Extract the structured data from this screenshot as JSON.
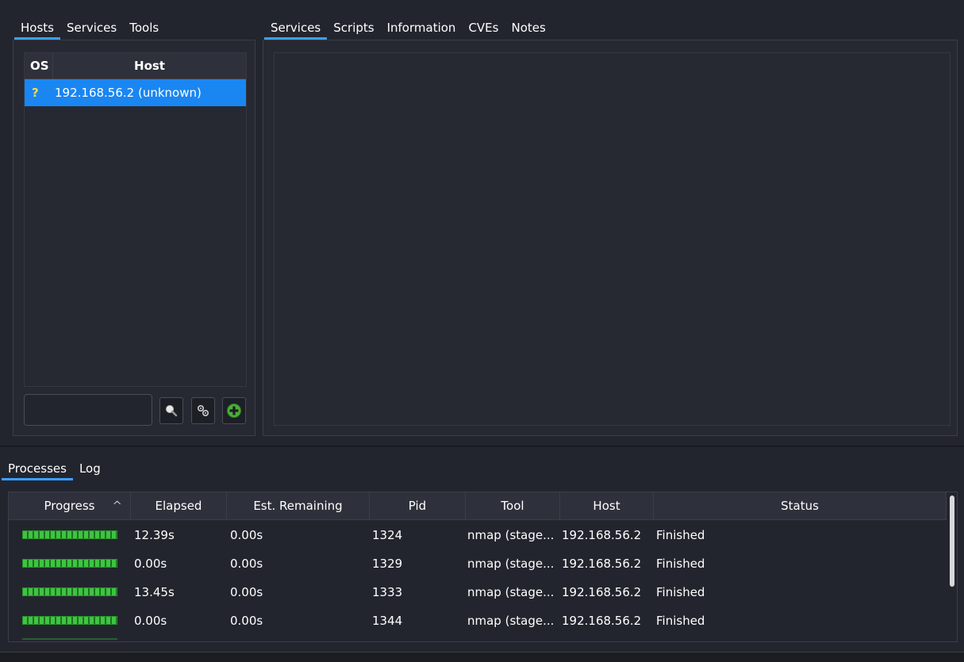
{
  "left_tabs": [
    {
      "label": "Hosts",
      "active": true
    },
    {
      "label": "Services",
      "active": false
    },
    {
      "label": "Tools",
      "active": false
    }
  ],
  "right_tabs": [
    {
      "label": "Services",
      "active": true
    },
    {
      "label": "Scripts",
      "active": false
    },
    {
      "label": "Information",
      "active": false
    },
    {
      "label": "CVEs",
      "active": false
    },
    {
      "label": "Notes",
      "active": false
    }
  ],
  "hosts_table": {
    "columns": [
      "OS",
      "Host"
    ],
    "rows": [
      {
        "os": "?",
        "host": "192.168.56.2 (unknown)",
        "selected": true
      }
    ]
  },
  "host_filter": {
    "value": "",
    "placeholder": ""
  },
  "host_buttons": [
    "search-icon",
    "settings-icon",
    "add-icon"
  ],
  "bottom_tabs": [
    {
      "label": "Processes",
      "active": true
    },
    {
      "label": "Log",
      "active": false
    }
  ],
  "processes": {
    "columns": [
      "Progress",
      "Elapsed",
      "Est. Remaining",
      "Pid",
      "Tool",
      "Host",
      "Status"
    ],
    "sort_indicator": "^",
    "rows": [
      {
        "progress": 1.0,
        "elapsed": "12.39s",
        "remaining": "0.00s",
        "pid": "1324",
        "tool": "nmap (stage...",
        "host": "192.168.56.2",
        "status": "Finished"
      },
      {
        "progress": 1.0,
        "elapsed": "0.00s",
        "remaining": "0.00s",
        "pid": "1329",
        "tool": "nmap (stage...",
        "host": "192.168.56.2",
        "status": "Finished"
      },
      {
        "progress": 1.0,
        "elapsed": "13.45s",
        "remaining": "0.00s",
        "pid": "1333",
        "tool": "nmap (stage...",
        "host": "192.168.56.2",
        "status": "Finished"
      },
      {
        "progress": 1.0,
        "elapsed": "0.00s",
        "remaining": "0.00s",
        "pid": "1344",
        "tool": "nmap (stage...",
        "host": "192.168.56.2",
        "status": "Finished"
      }
    ]
  },
  "colors": {
    "accent": "#3aa0ff",
    "selection": "#1a86f2",
    "progress": "#3ec441",
    "background": "#23252e"
  }
}
